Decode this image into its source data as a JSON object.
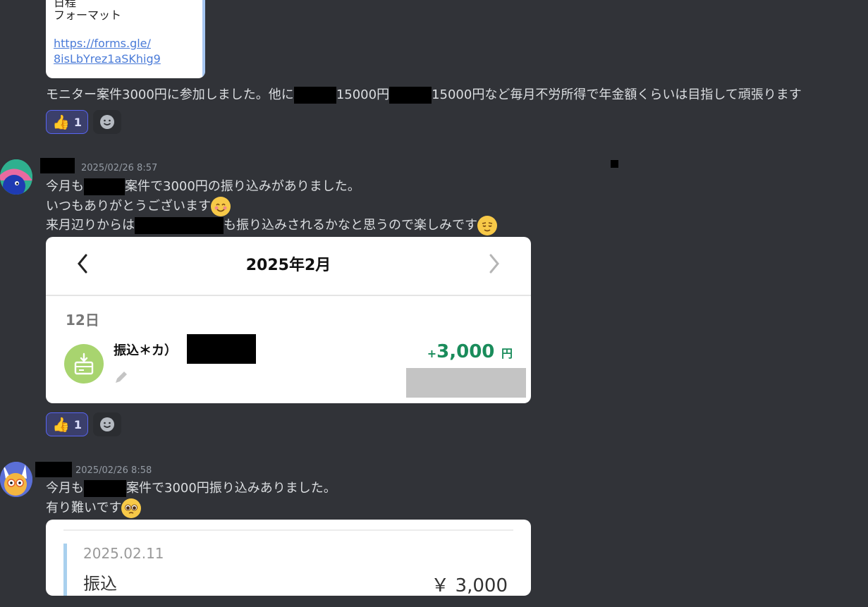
{
  "top_embed": {
    "line1": "フォーマット",
    "link_line1": "https://forms.gle/",
    "link_line2": "8isLbYrez1aSKhig9"
  },
  "messages": [
    {
      "text_a": "モニター案件3000円に参加しました。他に",
      "text_b": "15000円",
      "text_c": "15000円など毎月不労所得で年金額くらいは目指して頑張ります",
      "reaction_count": "1"
    },
    {
      "timestamp": "2025/02/26 8:57",
      "line1_a": "今月も",
      "line1_b": "案件で3000円の振り込みがありました。",
      "line2": "いつもありがとうございます",
      "line3_a": "来月辺りからは",
      "line3_b": "も振り込みされるかなと思うので楽しみです",
      "reaction_count": "1"
    },
    {
      "timestamp": "2025/02/26 8:58",
      "line1_a": "今月も",
      "line1_b": "案件で3000円振り込みありました。",
      "line2": "有り難いです"
    }
  ],
  "bank_card_1": {
    "month": "2025年2月",
    "day": "12日",
    "description": "振込＊カ）",
    "amount_sign": "+",
    "amount": "3,000",
    "currency": "円",
    "prev_icon": "chevron-left-icon",
    "next_icon": "chevron-right-icon"
  },
  "bank_card_2": {
    "date": "2025.02.11",
    "type": "振込",
    "amount": "￥ 3,000"
  },
  "colors": {
    "background": "#313338",
    "text": "#dbdee1",
    "link": "#4a7bd8",
    "amount_green": "#1a8c5b",
    "reaction_border": "#5865f2"
  }
}
